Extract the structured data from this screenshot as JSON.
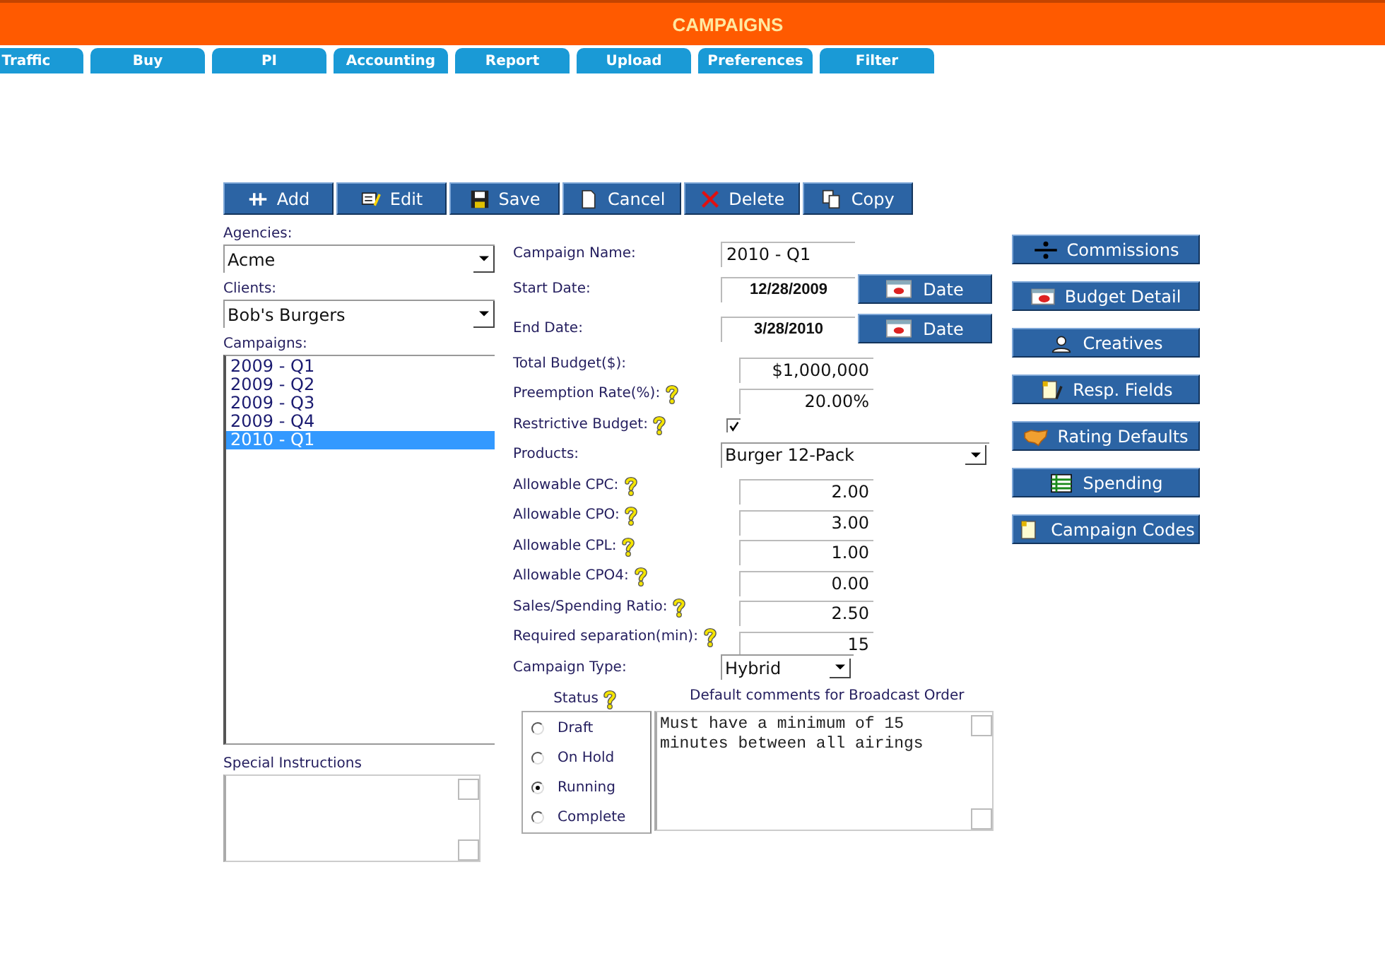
{
  "header": {
    "title": "CAMPAIGNS"
  },
  "tabs": [
    "Traffic",
    "Buy",
    "PI",
    "Accounting",
    "Report",
    "Upload",
    "Preferences",
    "Filter"
  ],
  "toolbar": [
    "Add",
    "Edit",
    "Save",
    "Cancel",
    "Delete",
    "Copy"
  ],
  "left": {
    "agencies_label": "Agencies:",
    "agency": "Acme",
    "clients_label": "Clients:",
    "client": "Bob's Burgers",
    "campaigns_label": "Campaigns:",
    "campaigns": [
      {
        "label": "2009 - Q1",
        "selected": false
      },
      {
        "label": "2009 - Q2",
        "selected": false
      },
      {
        "label": "2009 - Q3",
        "selected": false
      },
      {
        "label": "2009 - Q4",
        "selected": false
      },
      {
        "label": "2010 - Q1",
        "selected": true
      }
    ],
    "special_instructions_label": "Special Instructions"
  },
  "fields": [
    {
      "kind": "text",
      "label": "Campaign Name:",
      "value": "2010 - Q1",
      "help": false
    },
    {
      "kind": "date",
      "label": "Start Date:",
      "value": "12/28/2009",
      "button": "Date",
      "help": false
    },
    {
      "kind": "date",
      "label": "End Date:",
      "value": "3/28/2010",
      "button": "Date",
      "help": false
    },
    {
      "kind": "number",
      "label": "Total Budget($):",
      "value": "$1,000,000",
      "help": false
    },
    {
      "kind": "number",
      "label": "Preemption Rate(%):",
      "value": "20.00%",
      "help": true
    },
    {
      "kind": "checkbox",
      "label": "Restrictive Budget:",
      "checked": true,
      "help": true
    },
    {
      "kind": "select",
      "label": "Products:",
      "value": "Burger 12-Pack",
      "help": false
    },
    {
      "kind": "number",
      "label": "Allowable CPC:",
      "value": "2.00",
      "help": true
    },
    {
      "kind": "number",
      "label": "Allowable CPO:",
      "value": "3.00",
      "help": true
    },
    {
      "kind": "number",
      "label": "Allowable CPL:",
      "value": "1.00",
      "help": true
    },
    {
      "kind": "number",
      "label": "Allowable CPO4:",
      "value": "0.00",
      "help": true
    },
    {
      "kind": "number",
      "label": "Sales/Spending Ratio:",
      "value": "2.50",
      "help": true
    },
    {
      "kind": "number",
      "label": "Required separation(min):",
      "value": "15",
      "help": true
    },
    {
      "kind": "short-select",
      "label": "Campaign Type:",
      "value": "Hybrid",
      "help": false
    }
  ],
  "status": {
    "label": "Status",
    "options": [
      {
        "label": "Draft",
        "selected": false
      },
      {
        "label": "On Hold",
        "selected": false
      },
      {
        "label": "Running",
        "selected": true
      },
      {
        "label": "Complete",
        "selected": false
      }
    ]
  },
  "comments": {
    "label": "Default comments for Broadcast Order",
    "value": "Must have a minimum of 15 minutes between all airings"
  },
  "side_buttons": [
    "Commissions",
    "Budget Detail",
    "Creatives",
    "Resp. Fields",
    "Rating Defaults",
    "Spending",
    "Campaign Codes"
  ]
}
